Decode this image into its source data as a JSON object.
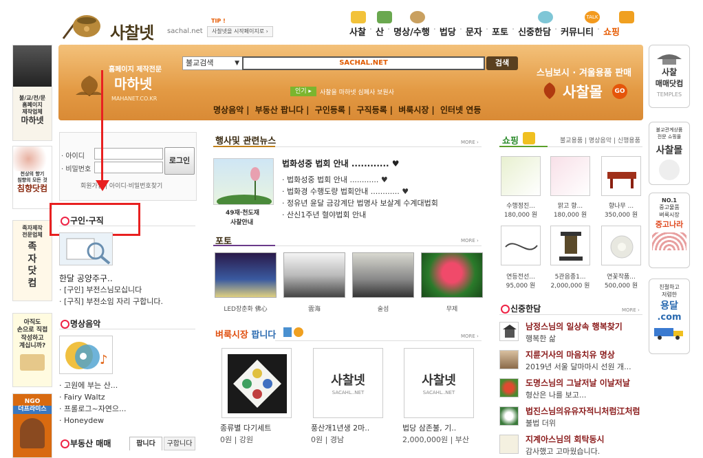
{
  "header": {
    "logo_text": "사찰넷",
    "logo_url": "sachal.net",
    "tip_label": "TIP !",
    "tip_text": "사찰넷을 시작페이지로 ›",
    "nav": [
      "사찰",
      "산",
      "명상/수행",
      "법당",
      "문자",
      "포토",
      "신중한담",
      "커뮤니티",
      "쇼핑"
    ]
  },
  "banner": {
    "mahanet_small": "홈페이지 제작전문",
    "mahanet_big": "마하넷",
    "mahanet_url": "MAHANET.CO.KR",
    "search_select": "불교검색",
    "search_value": "SACHAL.NET",
    "search_button": "검색",
    "popular_tag": "인기 ▸",
    "popular_text": "사찰을 마하넷 심폐사 보원사",
    "links": [
      "명상음악",
      "부동산 팝니다",
      "구인등록",
      "구직등록",
      "벼룩시장",
      "인터넷 연등"
    ],
    "shop_line1": "스님보시 · 겨울용품 판매",
    "shop_line2": "사찰몰",
    "shop_go": "GO"
  },
  "left_ads": {
    "ad1_lines": [
      "불/교/전/문",
      "홈페이지",
      "제작업체",
      "마하넷"
    ],
    "ad2_lines": [
      "천상의 향기",
      "침향의 모든 것",
      "침향닷컴"
    ],
    "ad3_lines": [
      "족자제작",
      "전문업체",
      "족",
      "자",
      "닷",
      "컴"
    ],
    "ad4_lines": [
      "아직도",
      "손으로 직접",
      "작성하고",
      "계십니까?"
    ],
    "ad5_lines": [
      "NGO",
      "더프라미스"
    ]
  },
  "login": {
    "id_label": "· 아이디",
    "pw_label": "· 비밀번호",
    "login_button": "로그인",
    "join": "회원가입",
    "find": "아이디·비밀번호찾기"
  },
  "job": {
    "title": "구인·구직",
    "headline": "한달 공양주구..",
    "items": [
      "· [구인] 부전스님모십니다",
      "· [구직] 부전소임 자리 구합니다."
    ]
  },
  "music": {
    "title": "명상음악",
    "items": [
      "· 고원에 부는 산...",
      "· Fairy Waltz",
      "· 프롤로그~자연으...",
      "· Honeydew"
    ]
  },
  "realestate": {
    "title": "부동산 매매",
    "tab_sell": "팝니다",
    "tab_buy": "구합니다"
  },
  "events": {
    "title": "행사및 관련뉴스",
    "more": "MORE ›",
    "thumb_caption1": "49재·천도재",
    "thumb_caption2": "사찰안내",
    "headline": "법화성중 법회 안내 ............ ♥",
    "items": [
      "· 법화성중 법회 안내 ............ ♥",
      "· 법화경 수행도량 법회안내 ............ ♥",
      "· 정유년 윤달 금강계단 법명사 보살계 수계대법회",
      "· 산신1주년 혈야법회 안내"
    ]
  },
  "photo": {
    "title": "포토",
    "more": "MORE ›",
    "captions": [
      "LED장춘화 佛心",
      "雲海",
      "술섬",
      "무제"
    ]
  },
  "market": {
    "title_a": "벼룩시장",
    "title_b": "팝니다",
    "more": "MORE ›",
    "placeholder_logo": "사찰넷",
    "placeholder_sub": "SACAHL..NET",
    "items": [
      {
        "name": "종류별 다기세트",
        "meta": "0원 | 강원"
      },
      {
        "name": "풍산개1년생 2마..",
        "meta": "0원 | 경남"
      },
      {
        "name": "법당 삼존불, 기..",
        "meta": "2,000,000원 | 부산"
      }
    ]
  },
  "shopping": {
    "title": "쇼핑",
    "tabs": "불교용품 | 명상음악 | 신행용품",
    "items": [
      {
        "name": "수행정진...",
        "price": "180,000 원"
      },
      {
        "name": "맑고 향...",
        "price": "180,000 원"
      },
      {
        "name": "향나무 ...",
        "price": "350,000 원"
      },
      {
        "name": "연등전선...",
        "price": "95,000 원"
      },
      {
        "name": "5관음종1...",
        "price": "2,000,000 원"
      },
      {
        "name": "연꽃작품...",
        "price": "500,000 원"
      }
    ]
  },
  "sinjung": {
    "title": "신중한담",
    "more": "MORE ›",
    "items": [
      {
        "title": "남정스님의 일상속 행복찾기",
        "sub": "행복한 삶"
      },
      {
        "title": "지륜거사의 마음치유 명상",
        "sub": "2019년 서울 달마마시 선원 개..."
      },
      {
        "title": "도명스님의 그날저날 이날저날",
        "sub": "형산은 나를 보고..."
      },
      {
        "title": "법진스님의유유자적니처럼江처럼",
        "sub": "불법 더위"
      },
      {
        "title": "지계아스님의 회탁동시",
        "sub": "감사했고 고마웠습니다."
      }
    ]
  },
  "right_ads": {
    "ad1_lines": [
      "사찰",
      "매매닷컴",
      "TEMPLES"
    ],
    "ad2_lines": [
      "불교관계상품",
      "전문 쇼핑몰",
      "사찰몰"
    ],
    "ad3_lines": [
      "NO.1",
      "중고물품",
      "벼룩시장",
      "중고나라"
    ],
    "ad4_lines": [
      "친절하고",
      "저렴한",
      "용달",
      ".com"
    ]
  },
  "colors": {
    "accent": "#e65a00",
    "banner": "#e39a44",
    "highlight_red": "#e82020",
    "heading_brown": "#8a1a1a"
  }
}
